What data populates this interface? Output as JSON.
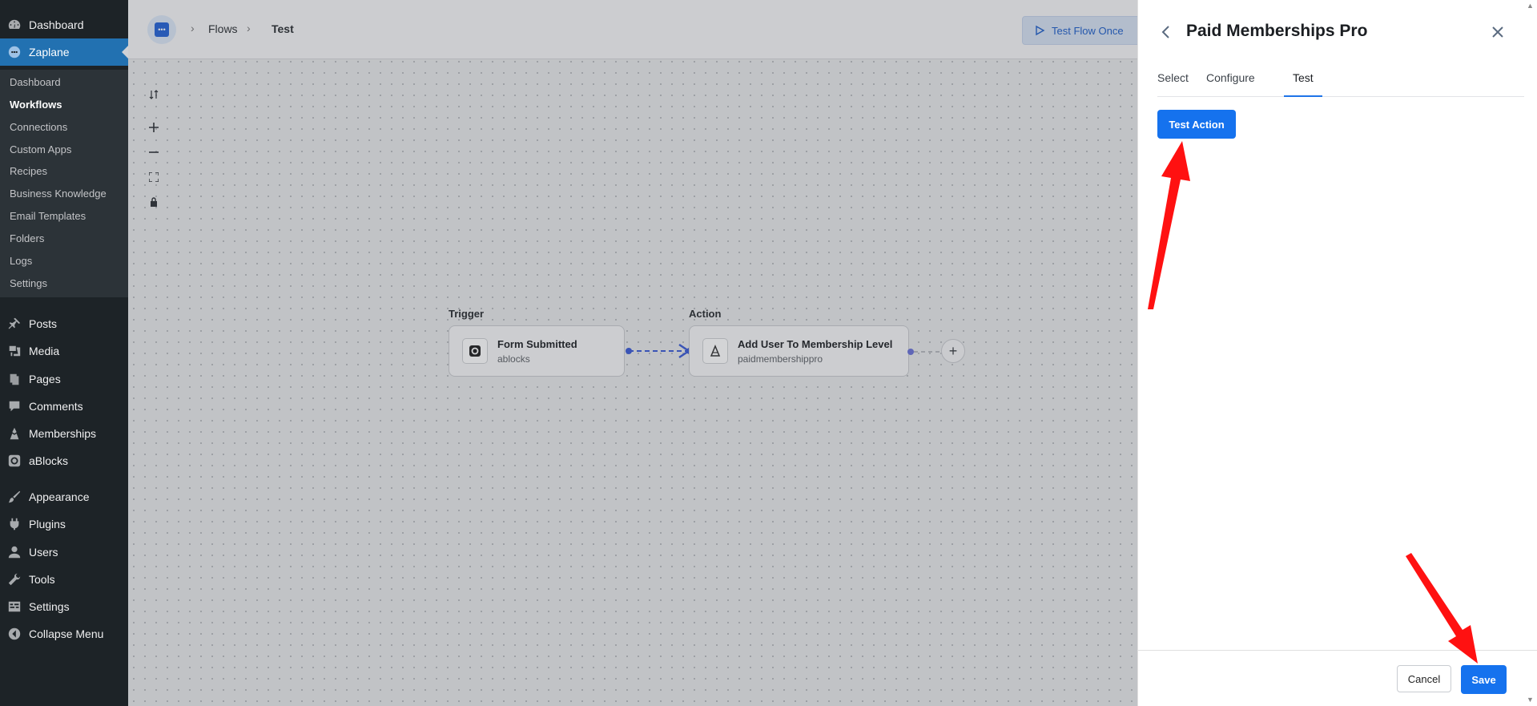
{
  "sidebar": {
    "top_items": [
      {
        "label": "Dashboard",
        "icon": "dashboard-icon"
      },
      {
        "label": "Zaplane",
        "icon": "zaplane-icon"
      }
    ],
    "zaplane_submenu": [
      {
        "label": "Dashboard"
      },
      {
        "label": "Workflows"
      },
      {
        "label": "Connections"
      },
      {
        "label": "Custom Apps"
      },
      {
        "label": "Recipes"
      },
      {
        "label": "Business Knowledge"
      },
      {
        "label": "Email Templates"
      },
      {
        "label": "Folders"
      },
      {
        "label": "Logs"
      },
      {
        "label": "Settings"
      }
    ],
    "menu_items": [
      {
        "label": "Posts",
        "icon": "pin-icon"
      },
      {
        "label": "Media",
        "icon": "media-icon"
      },
      {
        "label": "Pages",
        "icon": "pages-icon"
      },
      {
        "label": "Comments",
        "icon": "comment-icon"
      },
      {
        "label": "Memberships",
        "icon": "memberships-icon"
      },
      {
        "label": "aBlocks",
        "icon": "ablocks-icon"
      },
      {
        "label": "Appearance",
        "icon": "brush-icon"
      },
      {
        "label": "Plugins",
        "icon": "plug-icon"
      },
      {
        "label": "Users",
        "icon": "user-icon"
      },
      {
        "label": "Tools",
        "icon": "wrench-icon"
      },
      {
        "label": "Settings",
        "icon": "settings-icon"
      },
      {
        "label": "Collapse Menu",
        "icon": "collapse-icon"
      }
    ]
  },
  "topbar": {
    "breadcrumb": [
      "Flows",
      "Test"
    ],
    "test_flow_label": "Test Flow Once"
  },
  "flow": {
    "trigger": {
      "section_label": "Trigger",
      "title": "Form Submitted",
      "subtitle": "ablocks"
    },
    "action": {
      "section_label": "Action",
      "title": "Add User To Membership Level",
      "subtitle": "paidmembershippro"
    }
  },
  "panel": {
    "title": "Paid Memberships Pro",
    "tabs": [
      {
        "label": "Select"
      },
      {
        "label": "Configure"
      },
      {
        "label": "Test"
      }
    ],
    "active_tab": "Test",
    "test_action_label": "Test Action",
    "cancel_label": "Cancel",
    "save_label": "Save"
  },
  "colors": {
    "primary": "#1572ee",
    "sidebar_bg": "#1d2327",
    "sidebar_current": "#2271b1",
    "annotation_arrow": "#ff0000"
  }
}
